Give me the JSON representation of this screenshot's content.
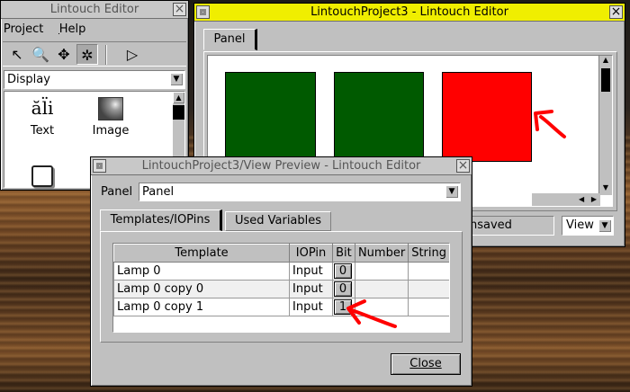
{
  "editor": {
    "title": "Lintouch Editor",
    "menu": {
      "project": "Project",
      "help": "Help"
    },
    "tools": [
      {
        "name": "pointer-icon",
        "glyph": "↖"
      },
      {
        "name": "zoom-icon",
        "glyph": "🔍"
      },
      {
        "name": "move-icon",
        "glyph": "✥"
      },
      {
        "name": "settings-icon",
        "glyph": "✲"
      },
      {
        "name": "run-icon",
        "glyph": "▷"
      }
    ],
    "category": "Display",
    "palette": [
      {
        "label": "Text"
      },
      {
        "label": "Image"
      },
      {
        "label": ""
      }
    ]
  },
  "project": {
    "title": "LintouchProject3 - Lintouch Editor",
    "tab": "Panel",
    "lamps": [
      {
        "color": "#005a00"
      },
      {
        "color": "#005a00"
      },
      {
        "color": "#ff0000"
      }
    ],
    "status_text": "Unsaved",
    "status_visible": "nsaved",
    "view_label": "View"
  },
  "preview": {
    "title": "LintouchProject3/View Preview - Lintouch Editor",
    "panel_label": "Panel",
    "panel_value": "Panel",
    "tabs": [
      "Templates/IOPins",
      "Used Variables"
    ],
    "columns": [
      "Template",
      "IOPin",
      "Bit",
      "Number",
      "String"
    ],
    "rows": [
      {
        "template": "Lamp 0",
        "iopin": "Input",
        "bit": "0",
        "number": "",
        "string": ""
      },
      {
        "template": "Lamp 0 copy 0",
        "iopin": "Input",
        "bit": "0",
        "number": "",
        "string": ""
      },
      {
        "template": "Lamp 0 copy 1",
        "iopin": "Input",
        "bit": "1",
        "number": "",
        "string": ""
      }
    ],
    "close_label": "Close"
  },
  "annotation_color": "#ff0000"
}
